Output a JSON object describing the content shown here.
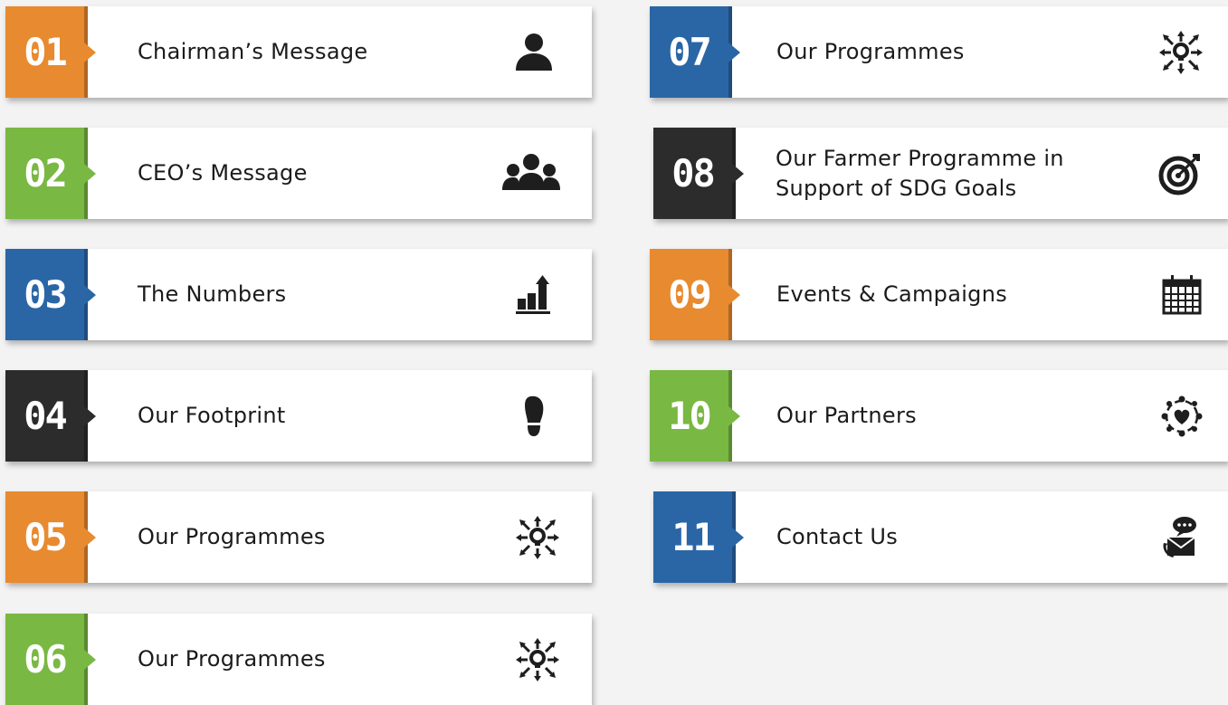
{
  "items": [
    {
      "number": "01",
      "label": "Chairman’s Message",
      "icon": "person-icon",
      "color": "#e88a2f"
    },
    {
      "number": "02",
      "label": "CEO’s  Message",
      "icon": "team-icon",
      "color": "#79b843"
    },
    {
      "number": "03",
      "label": "The Numbers",
      "icon": "growth-chart-icon",
      "color": "#2a66a6"
    },
    {
      "number": "04",
      "label": "Our Footprint",
      "icon": "footprint-icon",
      "color": "#2c2c2c"
    },
    {
      "number": "05",
      "label": "Our Programmes",
      "icon": "idea-arrows-icon",
      "color": "#e88a2f"
    },
    {
      "number": "06",
      "label": "Our Programmes",
      "icon": "idea-arrows-icon",
      "color": "#79b843"
    },
    {
      "number": "07",
      "label": "Our Programmes",
      "icon": "idea-arrows-icon",
      "color": "#2a66a6"
    },
    {
      "number": "08",
      "label": "Our Farmer Programme in Support of SDG Goals",
      "icon": "target-icon",
      "color": "#2c2c2c"
    },
    {
      "number": "09",
      "label": "Events & Campaigns",
      "icon": "calendar-icon",
      "color": "#e88a2f"
    },
    {
      "number": "10",
      "label": "Our Partners",
      "icon": "heart-network-icon",
      "color": "#79b843"
    },
    {
      "number": "11",
      "label": "Contact Us",
      "icon": "contact-chat-icon",
      "color": "#2a66a6"
    }
  ]
}
